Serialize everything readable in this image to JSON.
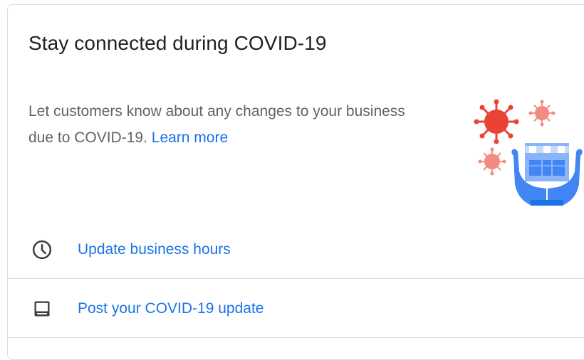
{
  "card": {
    "title": "Stay connected during COVID-19",
    "description": "Let customers know about any changes to your business due to COVID-19.",
    "learn_more": "Learn more"
  },
  "actions": [
    {
      "label": "Update business hours",
      "icon": "clock-icon"
    },
    {
      "label": "Post your COVID-19 update",
      "icon": "post-icon"
    }
  ],
  "colors": {
    "link": "#1a73e8",
    "title": "#202124",
    "body_text": "#5f6368",
    "divider": "#dadce0",
    "virus_red": "#ea4335",
    "store_blue": "#4285f4"
  }
}
